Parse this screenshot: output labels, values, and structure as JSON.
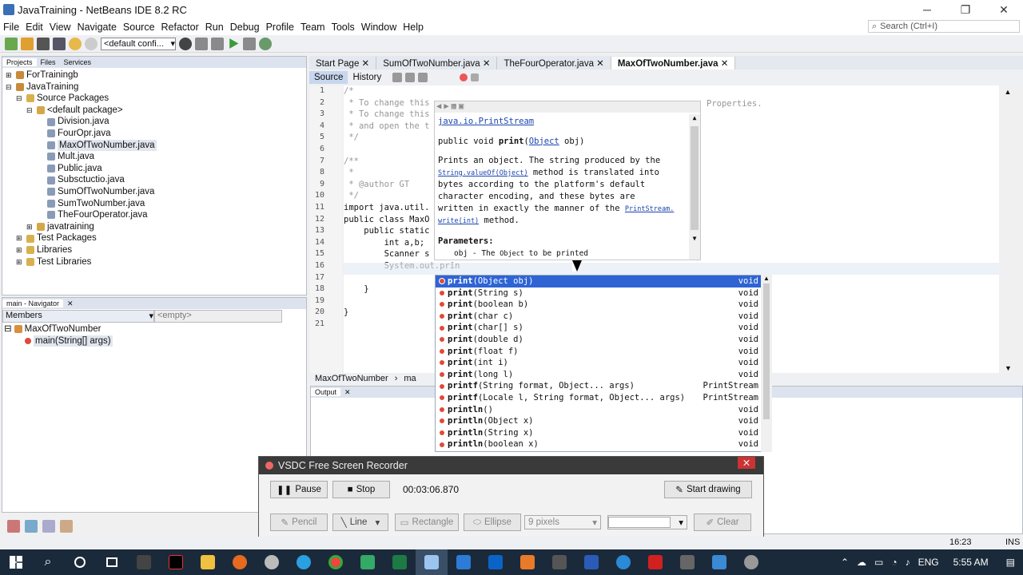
{
  "window": {
    "title": "JavaTraining - NetBeans IDE 8.2 RC",
    "minimize": "─",
    "restore": "❐",
    "close": "✕"
  },
  "menu": [
    "File",
    "Edit",
    "View",
    "Navigate",
    "Source",
    "Refactor",
    "Run",
    "Debug",
    "Profile",
    "Team",
    "Tools",
    "Window",
    "Help"
  ],
  "search": {
    "placeholder": "Search (Ctrl+I)"
  },
  "toolbar": {
    "config": "<default confi..."
  },
  "projects": {
    "tabs": [
      "Projects",
      "Files",
      "Services"
    ],
    "tree": [
      {
        "label": "ForTrainingb",
        "depth": 0,
        "expander": "+",
        "icon": "project"
      },
      {
        "label": "JavaTraining",
        "depth": 0,
        "expander": "-",
        "icon": "project"
      },
      {
        "label": "Source Packages",
        "depth": 1,
        "expander": "-",
        "icon": "folder"
      },
      {
        "label": "<default package>",
        "depth": 2,
        "expander": "-",
        "icon": "package"
      },
      {
        "label": "Division.java",
        "depth": 3,
        "icon": "java"
      },
      {
        "label": "FourOpr.java",
        "depth": 3,
        "icon": "java"
      },
      {
        "label": "MaxOfTwoNumber.java",
        "depth": 3,
        "icon": "java",
        "selected": true
      },
      {
        "label": "Mult.java",
        "depth": 3,
        "icon": "java"
      },
      {
        "label": "Public.java",
        "depth": 3,
        "icon": "java"
      },
      {
        "label": "Subsctuctio.java",
        "depth": 3,
        "icon": "java"
      },
      {
        "label": "SumOfTwoNumber.java",
        "depth": 3,
        "icon": "java"
      },
      {
        "label": "SumTwoNumber.java",
        "depth": 3,
        "icon": "java"
      },
      {
        "label": "TheFourOperator.java",
        "depth": 3,
        "icon": "java"
      },
      {
        "label": "javatraining",
        "depth": 2,
        "expander": "+",
        "icon": "package"
      },
      {
        "label": "Test Packages",
        "depth": 1,
        "expander": "+",
        "icon": "folder"
      },
      {
        "label": "Libraries",
        "depth": 1,
        "expander": "+",
        "icon": "folder"
      },
      {
        "label": "Test Libraries",
        "depth": 1,
        "expander": "+",
        "icon": "folder"
      }
    ]
  },
  "navigator": {
    "tab": "main - Navigator",
    "members": "Members",
    "empty": "<empty>",
    "class": "MaxOfTwoNumber",
    "method": "main(String[] args)"
  },
  "editor": {
    "tabs": [
      "Start Page",
      "SumOfTwoNumber.java",
      "TheFourOperator.java",
      "MaxOfTwoNumber.java"
    ],
    "active": 3,
    "source": "Source",
    "history": "History",
    "lines": [
      "1",
      "2",
      "3",
      "4",
      "5",
      "6",
      "7",
      "8",
      "9",
      "10",
      "11",
      "12",
      "13",
      "14",
      "15",
      "16",
      "17",
      "18",
      "19",
      "20",
      "21"
    ],
    "code": [
      "/*",
      " * To change this",
      " * To change this",
      " * and open the t",
      " */",
      "",
      "/**",
      " *",
      " * @author GT",
      " */",
      "import java.util.",
      "public class MaxO",
      "    public static",
      "        int a,b;",
      "        Scanner s",
      "        System.out.prin",
      "",
      "    }",
      "",
      "}",
      ""
    ],
    "right_text": "Properties.",
    "breadcrumb1": "MaxOfTwoNumber",
    "breadcrumb2": "ma"
  },
  "javadoc": {
    "class_link": "java.io.PrintStream",
    "signature_pre": "public void ",
    "signature_name": "print",
    "signature_open": "(",
    "signature_type": "Object",
    "signature_rest": " obj)",
    "desc1": "Prints an object. The string produced by the",
    "desc2_link": "String.valueOf(Object)",
    "desc2": " method is translated into",
    "desc3": "bytes according to the platform's default",
    "desc4": "character encoding, and these bytes are",
    "desc5": "written in exactly the manner of the ",
    "desc5_link": "PrintStream.",
    "desc6_link": "write(int)",
    "desc6": " method.",
    "params": "Parameters:",
    "param_obj": "obj",
    "param_obj_desc": " - The ",
    "param_obj_type": "Object",
    "param_obj_end": " to be printed"
  },
  "completion": [
    {
      "name": "print",
      "args": "(Object obj)",
      "ret": "void"
    },
    {
      "name": "print",
      "args": "(String s)",
      "ret": "void"
    },
    {
      "name": "print",
      "args": "(boolean b)",
      "ret": "void"
    },
    {
      "name": "print",
      "args": "(char c)",
      "ret": "void"
    },
    {
      "name": "print",
      "args": "(char[] s)",
      "ret": "void"
    },
    {
      "name": "print",
      "args": "(double d)",
      "ret": "void"
    },
    {
      "name": "print",
      "args": "(float f)",
      "ret": "void"
    },
    {
      "name": "print",
      "args": "(int i)",
      "ret": "void"
    },
    {
      "name": "print",
      "args": "(long l)",
      "ret": "void"
    },
    {
      "name": "printf",
      "args": "(String format, Object... args)",
      "ret": "PrintStream"
    },
    {
      "name": "printf",
      "args": "(Locale l, String format, Object... args)",
      "ret": "PrintStream"
    },
    {
      "name": "println",
      "args": "()",
      "ret": "void"
    },
    {
      "name": "println",
      "args": "(Object x)",
      "ret": "void"
    },
    {
      "name": "println",
      "args": "(String x)",
      "ret": "void"
    },
    {
      "name": "println",
      "args": "(boolean x)",
      "ret": "void"
    }
  ],
  "output": {
    "tab": "Output"
  },
  "recorder": {
    "title": "VSDC Free Screen Recorder",
    "pause": "Pause",
    "stop": "Stop",
    "time": "00:03:06.870",
    "start_drawing": "Start drawing",
    "pencil": "Pencil",
    "line": "Line",
    "rectangle": "Rectangle",
    "ellipse": "Ellipse",
    "pixels": "9 pixels",
    "clear": "Clear"
  },
  "status": {
    "position": "16:23",
    "mode": "INS"
  },
  "taskbar": {
    "lang": "ENG",
    "time": "5:55 AM"
  }
}
